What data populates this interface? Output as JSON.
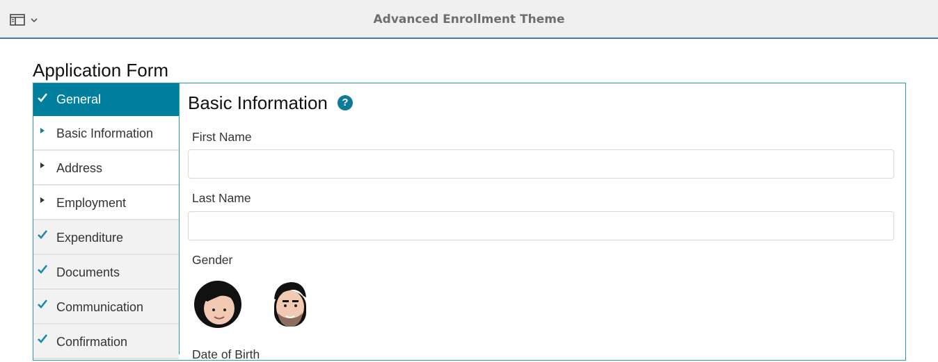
{
  "header": {
    "title": "Advanced Enrollment Theme",
    "panel_toggle_icon": "sidebar-panel-icon",
    "dropdown_icon": "chevron-down-icon"
  },
  "form": {
    "title": "Application Form"
  },
  "nav": {
    "items": [
      {
        "label": "General",
        "state": "active",
        "icon": "checkmark-icon"
      },
      {
        "label": "Basic Information",
        "state": "expandable",
        "icon": "triangle-right-icon"
      },
      {
        "label": "Address",
        "state": "expandable",
        "icon": "triangle-right-icon"
      },
      {
        "label": "Employment",
        "state": "expandable",
        "icon": "triangle-right-icon"
      },
      {
        "label": "Expenditure",
        "state": "complete",
        "icon": "checkmark-icon"
      },
      {
        "label": "Documents",
        "state": "complete",
        "icon": "checkmark-icon"
      },
      {
        "label": "Communication",
        "state": "complete",
        "icon": "checkmark-icon"
      },
      {
        "label": "Confirmation",
        "state": "complete",
        "icon": "checkmark-icon"
      }
    ]
  },
  "panel": {
    "heading": "Basic Information",
    "help_icon": "?",
    "fields": {
      "first_name": {
        "label": "First Name",
        "value": "",
        "placeholder": ""
      },
      "last_name": {
        "label": "Last Name",
        "value": "",
        "placeholder": ""
      },
      "gender": {
        "label": "Gender",
        "options": [
          "female-avatar-icon",
          "male-avatar-icon"
        ]
      },
      "date_of_birth": {
        "label": "Date of Birth"
      }
    }
  },
  "colors": {
    "accent": "#00809d",
    "frame": "#1f9bb5",
    "help": "#0d7a98"
  }
}
